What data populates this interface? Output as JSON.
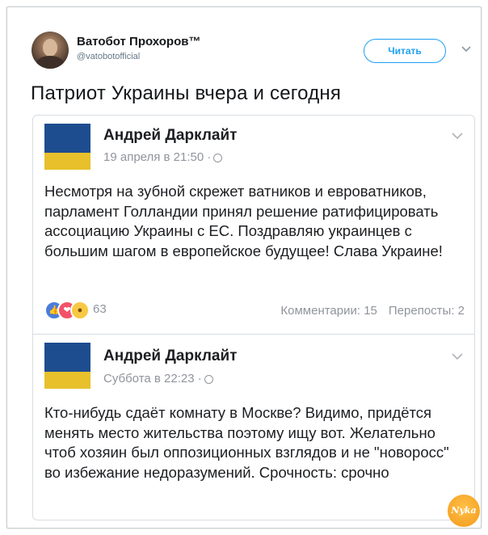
{
  "tweet": {
    "author_name": "Ватобот Прохоров™",
    "author_handle": "@vatobotofficial",
    "follow_label": "Читать",
    "text": "Патриот Украины вчера и сегодня"
  },
  "posts": [
    {
      "author": "Андрей Дарклайт",
      "meta": "19 апреля в 21:50 ·",
      "text": "Несмотря на зубной скрежет ватников и евроватников, парламент Голландии принял решение ратифицировать ассоциацию Украины с ЕС. Поздравляю украинцев с большим шагом в европейское будущее! Слава Украине!",
      "reaction_count": "63",
      "comments": "Комментарии: 15",
      "shares": "Перепосты: 2"
    },
    {
      "author": "Андрей Дарклайт",
      "meta": "Суббота в 22:23 ·",
      "text": "Кто-нибудь сдаёт комнату в Москве? Видимо, придётся менять место жительства поэтому ищу вот. Желательно чтоб хозяин был оппозиционных взглядов и не \"новоросс\" во избежание недоразумений. Срочность: срочно"
    }
  ],
  "watermark": "Nyka",
  "colors": {
    "follow_accent": "#1da1f2",
    "flag_blue": "#1e4d8f",
    "flag_yellow": "#e7c02b",
    "meta_gray": "#90949c"
  },
  "icons": {
    "dropdown": "chevron-down-icon",
    "privacy": "globe-icon",
    "reactions": [
      "like-icon",
      "love-icon",
      "wow-icon"
    ]
  }
}
